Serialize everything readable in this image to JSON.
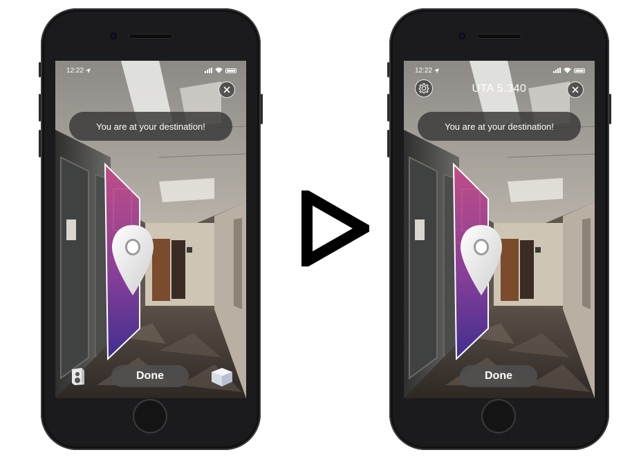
{
  "left_screen": {
    "status_time": "12:22",
    "toast": "You are at your destination!",
    "done_label": "Done",
    "icons": [
      "location-arrow-icon",
      "signal-icon",
      "wifi-icon",
      "battery-icon",
      "close-icon",
      "speaker-icon",
      "cube-icon",
      "map-pin-icon"
    ]
  },
  "right_screen": {
    "status_time": "12:22",
    "room_title": "UTA 5.340",
    "toast": "You are at your destination!",
    "done_label": "Done",
    "icons": [
      "location-arrow-icon",
      "signal-icon",
      "wifi-icon",
      "battery-icon",
      "gear-icon",
      "close-icon",
      "map-pin-icon"
    ]
  },
  "transition_icon": "play-arrow-icon",
  "colors": {
    "door_top": "#c04e86",
    "door_bottom": "#3f2f8f",
    "toast_bg": "#373737",
    "phone_body": "#1b1b1d"
  }
}
